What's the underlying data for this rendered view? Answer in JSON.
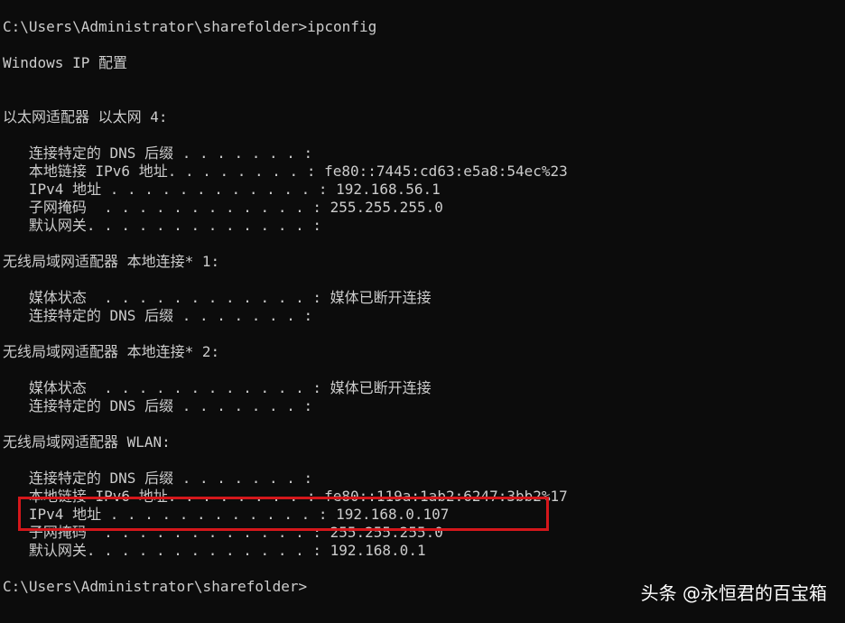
{
  "console": {
    "lines": [
      "C:\\Users\\Administrator\\sharefolder>ipconfig",
      "",
      "Windows IP 配置",
      "",
      "",
      "以太网适配器 以太网 4:",
      "",
      "   连接特定的 DNS 后缀 . . . . . . . :",
      "   本地链接 IPv6 地址. . . . . . . . : fe80::7445:cd63:e5a8:54ec%23",
      "   IPv4 地址 . . . . . . . . . . . . : 192.168.56.1",
      "   子网掩码  . . . . . . . . . . . . : 255.255.255.0",
      "   默认网关. . . . . . . . . . . . . :",
      "",
      "无线局域网适配器 本地连接* 1:",
      "",
      "   媒体状态  . . . . . . . . . . . . : 媒体已断开连接",
      "   连接特定的 DNS 后缀 . . . . . . . :",
      "",
      "无线局域网适配器 本地连接* 2:",
      "",
      "   媒体状态  . . . . . . . . . . . . : 媒体已断开连接",
      "   连接特定的 DNS 后缀 . . . . . . . :",
      "",
      "无线局域网适配器 WLAN:",
      "",
      "   连接特定的 DNS 后缀 . . . . . . . :",
      "   本地链接 IPv6 地址. . . . . . . . : fe80::119a:1ab2:6247:3bb2%17",
      "   IPv4 地址 . . . . . . . . . . . . : 192.168.0.107",
      "   子网掩码  . . . . . . . . . . . . : 255.255.255.0",
      "   默认网关. . . . . . . . . . . . . : 192.168.0.1",
      "",
      "C:\\Users\\Administrator\\sharefolder>"
    ]
  },
  "watermark": {
    "text": "头条 @永恒君的百宝箱"
  },
  "colors": {
    "background": "#0c0c0c",
    "text": "#cccccc",
    "highlight": "#d4171b"
  }
}
